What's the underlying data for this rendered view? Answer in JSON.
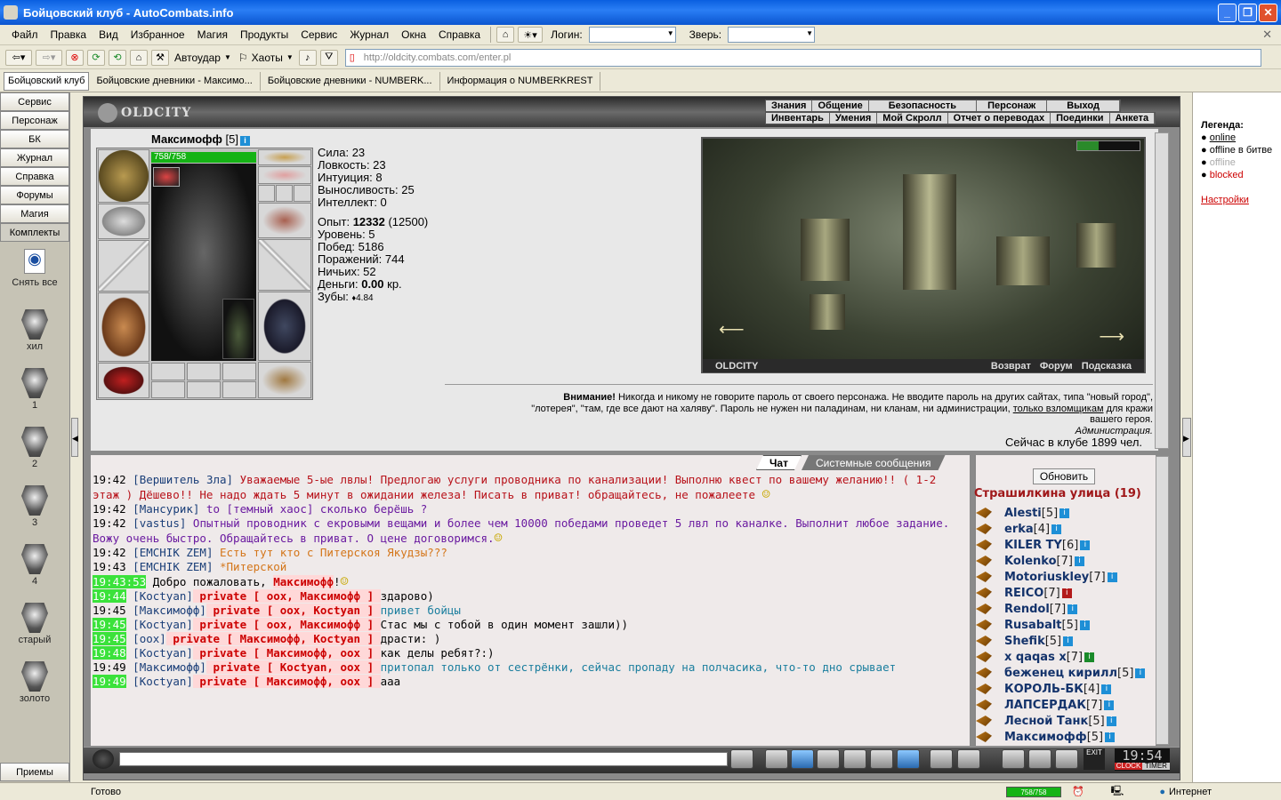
{
  "window": {
    "title": "Бойцовский клуб - AutoCombats.info"
  },
  "menu": [
    "Файл",
    "Правка",
    "Вид",
    "Избранное",
    "Магия",
    "Продукты",
    "Сервис",
    "Журнал",
    "Окна",
    "Справка"
  ],
  "login_label": "Логин:",
  "beast_label": "Зверь:",
  "toolbar": {
    "autoudar": "Автоудар",
    "haoty": "Хаоты"
  },
  "url": "http://oldcity.combats.com/enter.pl",
  "tabs": [
    "Бойцовский клуб",
    "Бойцовские дневники - Максимо...",
    "Бойцовские дневники - NUMBERK...",
    "Информация о NUMBERKREST"
  ],
  "left_buttons": [
    "Сервис",
    "Персонаж",
    "БК",
    "Журнал",
    "Справка",
    "Форумы",
    "Магия",
    "Комплекты"
  ],
  "left_spells": [
    {
      "label": "Снять все",
      "icon": "undress-icon"
    },
    {
      "label": "хил",
      "icon": "shield-icon"
    },
    {
      "label": "1",
      "icon": "shield-icon"
    },
    {
      "label": "2",
      "icon": "shield-icon"
    },
    {
      "label": "3",
      "icon": "shield-icon"
    },
    {
      "label": "4",
      "icon": "shield-icon"
    },
    {
      "label": "старый",
      "icon": "shield-icon"
    },
    {
      "label": "золото",
      "icon": "shield-icon"
    }
  ],
  "left_bottom": "Приемы",
  "game": {
    "logo": "OLDCITY",
    "menu_top": [
      "Знания",
      "Общение",
      "Безопасность",
      "Персонаж",
      "Выход"
    ],
    "menu_bottom": [
      "Инвентарь",
      "Умения",
      "Мой Скролл",
      "Отчет о переводах",
      "Поединки",
      "Анкета"
    ]
  },
  "character": {
    "name": "Максимофф",
    "level": "[5]",
    "hp": "758/758",
    "hp_fraction": 1.0,
    "stats": [
      "Сила: 23",
      "Ловкость: 23",
      "Интуиция: 8",
      "Выносливость: 25",
      "Интеллект: 0"
    ],
    "exp_label": "Опыт: ",
    "exp": "12332",
    "exp_next": " (12500)",
    "level_line": "Уровень: 5",
    "wins": "Побед: 5186",
    "losses": "Поражений: 744",
    "draws": "Ничьих: 52",
    "money_label": "Деньги: ",
    "money": "0.00",
    "money_unit": " кр.",
    "teeth_label": "Зубы: ",
    "teeth": "4.84"
  },
  "map": {
    "label": "OLDCITY",
    "links": [
      "Возврат",
      "Форум",
      "Подсказка"
    ]
  },
  "warning": {
    "bold": "Внимание!",
    "line1": " Никогда и никому не говорите пароль от своего персонажа. Не вводите пароль на других сайтах, типа \"новый город\",",
    "line2": "\"лотерея\", \"там, где все дают на халяву\". Пароль не нужен ни паладинам, ни кланам, ни администрации, ",
    "line2_u": "только взломщикам",
    "line2_end": " для кражи",
    "line3": "вашего героя.",
    "sign": "Администрация."
  },
  "online": "Сейчас в клубе 1899 чел.",
  "chat_tabs": [
    "Чат",
    "Системные сообщения"
  ],
  "chat": [
    {
      "ts": "19:42",
      "hl": false,
      "nick": "[Вершитель Зла]",
      "priv": "",
      "text": " Уважаемые 5-ые лвлы! Предлогаю услуги проводника по канализации! Выполню квест по вашему желанию!! ( 1-2 этаж ) Дёшево!! Не надо ждать 5 минут в ожидании железа! Писать в приват! обращайтесь, не пожалеете ",
      "color": "#b8121a"
    },
    {
      "ts": "19:42",
      "hl": false,
      "nick": "[Мансурик]",
      "priv": "",
      "text": " to [темный хаос] сколько берёшь ?",
      "color": "#6a1aa0"
    },
    {
      "ts": "19:42",
      "hl": false,
      "nick": "[vastus]",
      "priv": "",
      "text": " Опытный проводник с екровыми вещами и более чем 10000 победами проведет 5 лвл по каналке. Выполнит любое задание. Вожу очень быстро. Обращайтесь в приват. О цене договоримся.",
      "color": "#6a1aa0"
    },
    {
      "ts": "19:42",
      "hl": false,
      "nick": "[EMCHIK ZEM]",
      "priv": "",
      "text": " Есть тут кто с Питерскоя Якудзы???",
      "color": "#d4761a"
    },
    {
      "ts": "19:43",
      "hl": false,
      "nick": "[EMCHIK ZEM]",
      "priv": "",
      "text": " *Питерской",
      "color": "#d4761a"
    },
    {
      "ts": "19:43:53",
      "hl": true,
      "nick": "",
      "priv": "",
      "text": " Добро пожаловать, ",
      "color": "#000",
      "extra": "Максимофф",
      "extra2": "!"
    },
    {
      "ts": "19:44",
      "hl": true,
      "nick": "[Koctyan]",
      "priv": " private [ oox, Максимофф ] ",
      "text": "здарово)",
      "color": "#000"
    },
    {
      "ts": "19:45",
      "hl": false,
      "nick": "[Максимофф]",
      "priv": " private [ oox, Koctyan ] ",
      "text": "привет бойцы",
      "color": "#1a7e9e"
    },
    {
      "ts": "19:45",
      "hl": true,
      "nick": "[Koctyan]",
      "priv": " private [ oox, Максимофф ] ",
      "text": "Стас мы с тобой в один момент зашли))",
      "color": "#000"
    },
    {
      "ts": "19:45",
      "hl": true,
      "nick": "[oox]",
      "priv": " private [ Максимофф, Koctyan ] ",
      "text": "драсти: )",
      "color": "#000"
    },
    {
      "ts": "19:48",
      "hl": true,
      "nick": "[Koctyan]",
      "priv": " private [ Максимофф, oox ] ",
      "text": "как делы ребят?:)",
      "color": "#000"
    },
    {
      "ts": "19:49",
      "hl": false,
      "nick": "[Максимофф]",
      "priv": " private [ Koctyan, oox ] ",
      "text": "притопал только от сестрёнки, сейчас пропаду на полчасика, что-то дно срывает",
      "color": "#1a7e9e"
    },
    {
      "ts": "19:49",
      "hl": true,
      "nick": "[Koctyan]",
      "priv": " private [ Максимофф, oox ] ",
      "text": "ааа",
      "color": "#000"
    }
  ],
  "userlist": {
    "refresh": "Обновить",
    "room": "Страшилкина улица (19)",
    "users": [
      {
        "name": "Alesti",
        "lvl": "[5]",
        "info": "blue"
      },
      {
        "name": "erka",
        "lvl": "[4]",
        "info": "blue"
      },
      {
        "name": "KILER TY",
        "lvl": "[6]",
        "info": "blue"
      },
      {
        "name": "Kolenko",
        "lvl": "[7]",
        "info": "blue"
      },
      {
        "name": "Motoriuskley",
        "lvl": "[7]",
        "info": "blue"
      },
      {
        "name": "REICO",
        "lvl": "[7]",
        "info": "red"
      },
      {
        "name": "Rendol",
        "lvl": "[7]",
        "info": "blue"
      },
      {
        "name": "Rusabalt",
        "lvl": "[5]",
        "info": "blue"
      },
      {
        "name": "Shefik",
        "lvl": "[5]",
        "info": "blue"
      },
      {
        "name": "x qaqas x",
        "lvl": "[7]",
        "info": "green"
      },
      {
        "name": "беженец кирилл",
        "lvl": "[5]",
        "info": "blue"
      },
      {
        "name": "КОРОЛЬ-БК",
        "lvl": "[4]",
        "info": "blue"
      },
      {
        "name": "ЛАПСЕРДАК",
        "lvl": "[7]",
        "info": "blue"
      },
      {
        "name": "Лесной Танк",
        "lvl": "[5]",
        "info": "blue"
      },
      {
        "name": "Максимофф",
        "lvl": "[5]",
        "info": "blue"
      }
    ]
  },
  "clock": {
    "time": "19:54",
    "label1": "CLOCK",
    "label2": "TIMER",
    "exit": "EXIT"
  },
  "legend": {
    "title": "Легенда:",
    "items": [
      "online",
      "offline в битве",
      "offline",
      "blocked"
    ],
    "settings": "Настройки"
  },
  "status": {
    "left": "Готово",
    "hp": "758/758",
    "zone": "Интернет"
  },
  "colors": {
    "accent": "#0a5fe0",
    "room": "#a0181a",
    "nick": "#14336b",
    "private": "#cc0000",
    "hl": "#3be23b"
  }
}
